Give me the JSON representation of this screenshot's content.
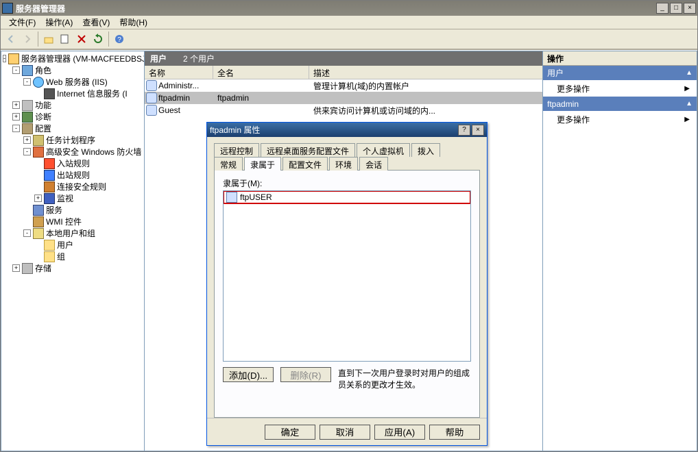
{
  "window": {
    "title": "服务器管理器"
  },
  "menus": {
    "file": "文件(F)",
    "action": "操作(A)",
    "view": "查看(V)",
    "help": "帮助(H)"
  },
  "tree": {
    "root": "服务器管理器 (VM-MACFEEDBSJ)",
    "roles": "角色",
    "web_iis": "Web 服务器 (IIS)",
    "iis_mgr": "Internet 信息服务 (I",
    "features": "功能",
    "diagnostics": "诊断",
    "config": "配置",
    "task_sched": "任务计划程序",
    "adv_fw": "高级安全 Windows 防火墙",
    "inbound": "入站规则",
    "outbound": "出站规则",
    "conn_sec": "连接安全规则",
    "monitor": "监视",
    "services": "服务",
    "wmi": "WMI 控件",
    "local_users": "本地用户和组",
    "users": "用户",
    "groups": "组",
    "storage": "存储"
  },
  "mid": {
    "title": "用户",
    "count": "2 个用户",
    "col_name": "名称",
    "col_full": "全名",
    "col_desc": "描述",
    "rows": {
      "0": {
        "name": "Administr...",
        "full": "",
        "desc": "管理计算机(域)的内置帐户"
      },
      "1": {
        "name": "ftpadmin",
        "full": "ftpadmin",
        "desc": ""
      },
      "2": {
        "name": "Guest",
        "full": "",
        "desc": "供来宾访问计算机或访问域的内..."
      }
    }
  },
  "actions": {
    "title": "操作",
    "sec1": "用户",
    "more1": "更多操作",
    "sec2": "ftpadmin",
    "more2": "更多操作"
  },
  "dialog": {
    "title": "ftpadmin 属性",
    "tabs": {
      "remote": "远程控制",
      "rds_profile": "远程桌面服务配置文件",
      "vm": "个人虚拟机",
      "dialin": "拨入",
      "general": "常规",
      "memberof": "隶属于",
      "profile": "配置文件",
      "env": "环境",
      "sessions": "会话"
    },
    "member_label": "隶属于(M):",
    "group_item": "ftpUSER",
    "btn_add": "添加(D)...",
    "btn_remove": "删除(R)",
    "hint": "直到下一次用户登录时对用户的组成员关系的更改才生效。",
    "btn_ok": "确定",
    "btn_cancel": "取消",
    "btn_apply": "应用(A)",
    "btn_help": "帮助"
  }
}
